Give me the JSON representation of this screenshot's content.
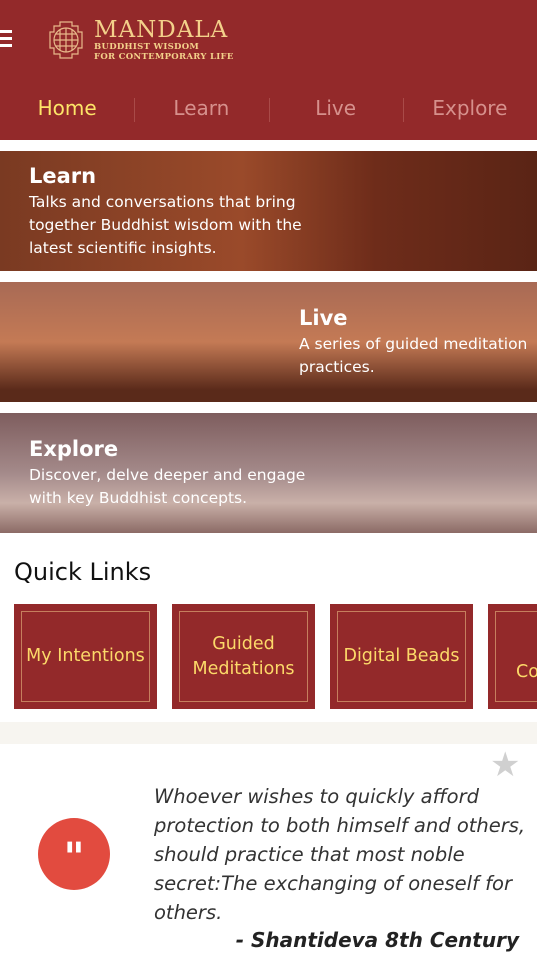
{
  "header": {
    "title": "MANDALA",
    "subtitle1": "BUDDHIST WISDOM",
    "subtitle2": "FOR CONTEMPORARY LIFE",
    "brand_color": "#93292a",
    "active_color": "#fde568"
  },
  "nav": [
    {
      "label": "Home",
      "active": true
    },
    {
      "label": "Learn"
    },
    {
      "label": "Live"
    },
    {
      "label": "Explore"
    }
  ],
  "banners": [
    {
      "title": "Learn",
      "text": "Talks and conversations that bring together Buddhist wisdom with the latest scientific insights."
    },
    {
      "title": "Live",
      "text": "A series of guided meditation practices."
    },
    {
      "title": "Explore",
      "text": "Discover, delve deeper and engage with key Buddhist concepts."
    }
  ],
  "quick_links": {
    "title": "Quick Links",
    "items": [
      "My Intentions",
      "Guided Meditations",
      "Digital Beads",
      "Con"
    ]
  },
  "quote": {
    "text": "Whoever wishes to quickly afford protection to both himself and others, should practice that most noble secret:The exchanging of oneself for others.",
    "author": "- Shantideva 8th Century",
    "icon": "quote-icon",
    "favorite_icon": "star-icon"
  }
}
